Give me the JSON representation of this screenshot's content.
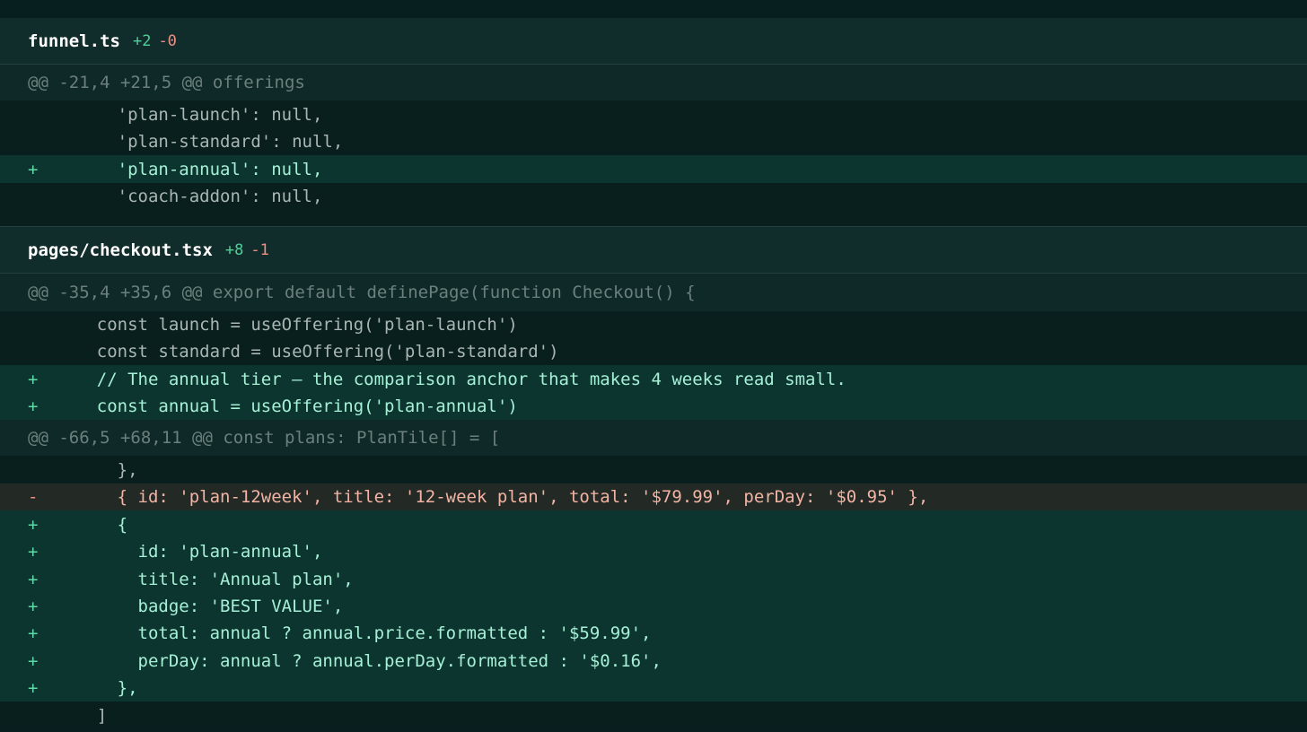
{
  "files": [
    {
      "name": "funnel.ts",
      "additions": "+2",
      "deletions": "-0",
      "hunks": [
        {
          "header": "@@ -21,4 +21,5 @@ offerings",
          "lines": [
            {
              "type": "ctx",
              "marker": "",
              "code": "      'plan-launch': null,"
            },
            {
              "type": "ctx",
              "marker": "",
              "code": "      'plan-standard': null,"
            },
            {
              "type": "add",
              "marker": "+",
              "code": "      'plan-annual': null,"
            },
            {
              "type": "ctx",
              "marker": "",
              "code": "      'coach-addon': null,"
            }
          ]
        }
      ]
    },
    {
      "name": "pages/checkout.tsx",
      "additions": "+8",
      "deletions": "-1",
      "hunks": [
        {
          "header": "@@ -35,4 +35,6 @@ export default definePage(function Checkout() {",
          "lines": [
            {
              "type": "ctx",
              "marker": "",
              "code": "    const launch = useOffering('plan-launch')"
            },
            {
              "type": "ctx",
              "marker": "",
              "code": "    const standard = useOffering('plan-standard')"
            },
            {
              "type": "add",
              "marker": "+",
              "code": "    // The annual tier — the comparison anchor that makes 4 weeks read small."
            },
            {
              "type": "add",
              "marker": "+",
              "code": "    const annual = useOffering('plan-annual')"
            }
          ]
        },
        {
          "header": "@@ -66,5 +68,11 @@ const plans: PlanTile[] = [",
          "lines": [
            {
              "type": "ctx",
              "marker": "",
              "code": "      },"
            },
            {
              "type": "del",
              "marker": "-",
              "code": "      { id: 'plan-12week', title: '12-week plan', total: '$79.99', perDay: '$0.95' },"
            },
            {
              "type": "add",
              "marker": "+",
              "code": "      {"
            },
            {
              "type": "add",
              "marker": "+",
              "code": "        id: 'plan-annual',"
            },
            {
              "type": "add",
              "marker": "+",
              "code": "        title: 'Annual plan',"
            },
            {
              "type": "add",
              "marker": "+",
              "code": "        badge: 'BEST VALUE',"
            },
            {
              "type": "add",
              "marker": "+",
              "code": "        total: annual ? annual.price.formatted : '$59.99',"
            },
            {
              "type": "add",
              "marker": "+",
              "code": "        perDay: annual ? annual.perDay.formatted : '$0.16',"
            },
            {
              "type": "add",
              "marker": "+",
              "code": "      },"
            },
            {
              "type": "ctx",
              "marker": "",
              "code": "    ]"
            }
          ]
        }
      ]
    }
  ]
}
